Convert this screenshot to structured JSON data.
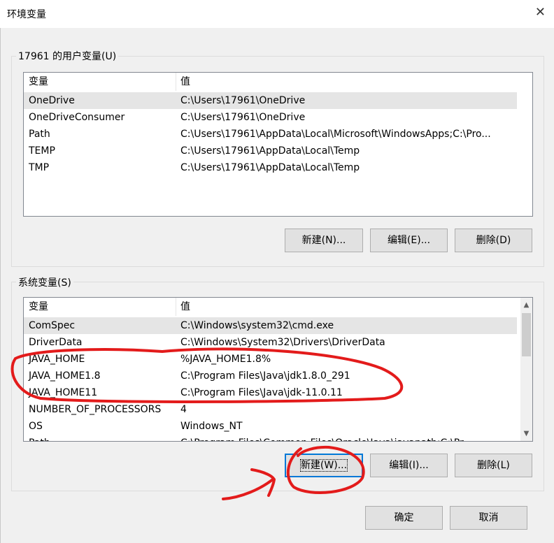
{
  "window": {
    "title": "环境变量",
    "close_glyph": "✕"
  },
  "user_vars": {
    "group_label": "17961 的用户变量(U)",
    "columns": [
      "变量",
      "值"
    ],
    "rows": [
      {
        "name": "OneDrive",
        "value": "C:\\Users\\17961\\OneDrive",
        "selected": true
      },
      {
        "name": "OneDriveConsumer",
        "value": "C:\\Users\\17961\\OneDrive"
      },
      {
        "name": "Path",
        "value": "C:\\Users\\17961\\AppData\\Local\\Microsoft\\WindowsApps;C:\\Pro..."
      },
      {
        "name": "TEMP",
        "value": "C:\\Users\\17961\\AppData\\Local\\Temp"
      },
      {
        "name": "TMP",
        "value": "C:\\Users\\17961\\AppData\\Local\\Temp"
      }
    ],
    "buttons": {
      "new": "新建(N)...",
      "edit": "编辑(E)...",
      "delete": "删除(D)"
    }
  },
  "system_vars": {
    "group_label": "系统变量(S)",
    "columns": [
      "变量",
      "值"
    ],
    "rows": [
      {
        "name": "ComSpec",
        "value": "C:\\Windows\\system32\\cmd.exe",
        "selected": true
      },
      {
        "name": "DriverData",
        "value": "C:\\Windows\\System32\\Drivers\\DriverData"
      },
      {
        "name": "JAVA_HOME",
        "value": "%JAVA_HOME1.8%"
      },
      {
        "name": "JAVA_HOME1.8",
        "value": "C:\\Program Files\\Java\\jdk1.8.0_291"
      },
      {
        "name": "JAVA_HOME11",
        "value": "C:\\Program Files\\Java\\jdk-11.0.11"
      },
      {
        "name": "NUMBER_OF_PROCESSORS",
        "value": "4"
      },
      {
        "name": "OS",
        "value": "Windows_NT"
      },
      {
        "name": "Path",
        "value": "C:\\Program Files\\Common Files\\Oracle\\Java\\javapath;C:\\Pr..."
      }
    ],
    "buttons": {
      "new": "新建(W)...",
      "edit": "编辑(I)...",
      "delete": "删除(L)"
    },
    "scrollbar": {
      "up_glyph": "▲",
      "down_glyph": "▼"
    }
  },
  "footer": {
    "ok": "确定",
    "cancel": "取消"
  },
  "annotation": {
    "color": "#e31b1b"
  }
}
